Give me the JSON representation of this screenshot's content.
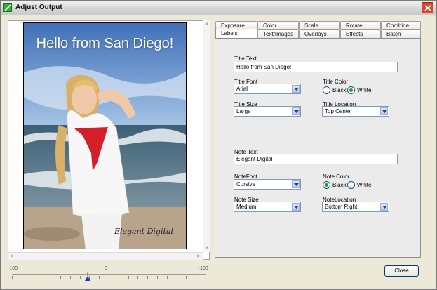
{
  "window": {
    "title": "Adjust Output"
  },
  "preview": {
    "photo_title": "Hello from San Diego!",
    "photo_note": "Elegant Digital"
  },
  "slider": {
    "min_label": "-100",
    "mid_label": "0",
    "max_label": "+100",
    "value": -22
  },
  "tabs": {
    "row1": [
      "Exposure",
      "Color",
      "Scale",
      "Rotate",
      "Combine"
    ],
    "row2": [
      "Labels",
      "Text/Images",
      "Overlays",
      "Effects",
      "Batch"
    ],
    "active": "Labels"
  },
  "form": {
    "title_text_label": "Title Text",
    "title_text_value": "Hello from San Diego!",
    "title_font_label": "Title Font",
    "title_font_value": "Arial",
    "title_color_label": "Title Color",
    "title_color_options": [
      "Black",
      "White"
    ],
    "title_color_selected": "White",
    "title_size_label": "Title Size",
    "title_size_value": "Large",
    "title_location_label": "Title Location",
    "title_location_value": "Top Center",
    "note_text_label": "Note Text",
    "note_text_value": "Elegant Digital",
    "note_font_label": "NoteFont",
    "note_font_value": "Cursive",
    "note_color_label": "Note Color",
    "note_color_options": [
      "Black",
      "White"
    ],
    "note_color_selected": "Black",
    "note_size_label": "Note Size",
    "note_size_value": "Medium",
    "note_location_label": "NoteLocation",
    "note_location_value": "Bottom Right"
  },
  "buttons": {
    "close_label": "Close"
  }
}
